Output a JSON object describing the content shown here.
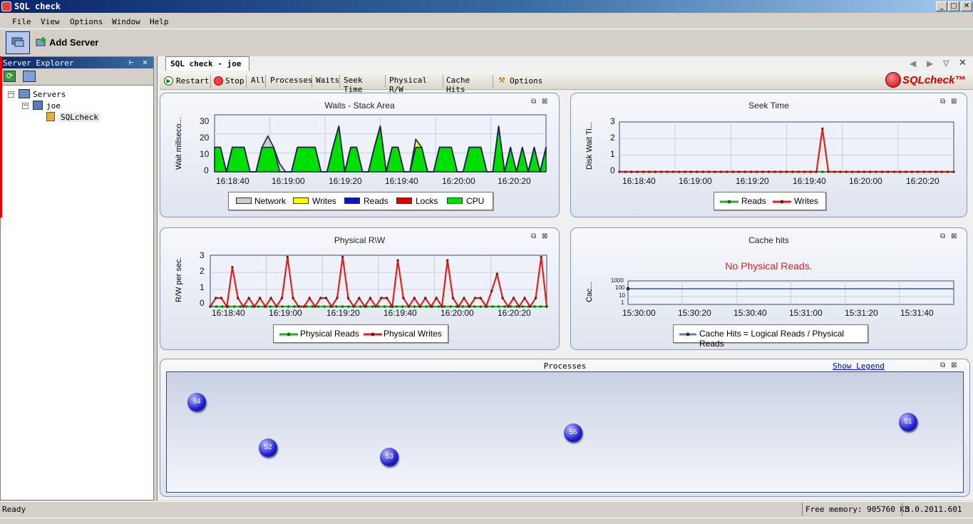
{
  "window": {
    "title": "SQL check"
  },
  "menu": [
    "File",
    "View",
    "Options",
    "Window",
    "Help"
  ],
  "toolbar": {
    "add_server": "Add Server"
  },
  "explorer": {
    "title": "Server Explorer",
    "tree": {
      "root": "Servers",
      "server": "joe",
      "db": "SQLcheck"
    }
  },
  "doc_tab": "SQL check - joe",
  "view_bar": {
    "restart": "Restart",
    "stop": "Stop",
    "views": [
      "All",
      "Processes",
      "Waits",
      "Seek Time",
      "Physical R/W",
      "Cache Hits"
    ],
    "options": "Options"
  },
  "brand": {
    "logo": "SQLcheck™"
  },
  "panels": {
    "waits": {
      "title": "Waits - Stack Area",
      "ylabel": "Wait millseco...",
      "yticks": [
        "30",
        "20",
        "10",
        "0"
      ],
      "xticks": [
        "16:18:40",
        "16:19:00",
        "16:19:20",
        "16:19:40",
        "16:20:00",
        "16:20:20"
      ],
      "legend": [
        "Network",
        "Writes",
        "Reads",
        "Locks",
        "CPU"
      ],
      "colors": [
        "#c8ccd4",
        "#ffff00",
        "#1010c0",
        "#e00000",
        "#00e000"
      ]
    },
    "seek": {
      "title": "Seek Time",
      "ylabel": "Disk Wait Ti...",
      "yticks": [
        "3",
        "2",
        "1",
        "0"
      ],
      "xticks": [
        "16:18:40",
        "16:19:00",
        "16:19:20",
        "16:19:40",
        "16:20:00",
        "16:20:20"
      ],
      "legend": [
        "Reads",
        "Writes"
      ]
    },
    "physical": {
      "title": "Physical R\\W",
      "ylabel": "R/W per sec.",
      "yticks": [
        "3",
        "2",
        "1",
        "0"
      ],
      "xticks": [
        "16:18:40",
        "16:19:00",
        "16:19:20",
        "16:19:40",
        "16:20:00",
        "16:20:20"
      ],
      "legend": [
        "Physical Reads",
        "Physical Writes"
      ]
    },
    "cache": {
      "title": "Cache hits",
      "message": "No Physical Reads.",
      "ylabel": "Cac...",
      "yticks": [
        "1000",
        "100",
        "10",
        "1"
      ],
      "xticks": [
        "15:30:00",
        "15:30:20",
        "15:30:40",
        "15:31:00",
        "15:31:20",
        "15:31:40"
      ],
      "legend": [
        "Cache Hits = Logical Reads / Physical Reads"
      ]
    },
    "processes": {
      "title": "Processes",
      "show_legend": "Show Legend",
      "balls": [
        "54",
        "52",
        "53",
        "56",
        "51"
      ]
    }
  },
  "chart_data": [
    {
      "type": "area",
      "title": "Waits - Stack Area",
      "ylabel": "Wait millseco...",
      "ylim": [
        0,
        35
      ],
      "series": [
        {
          "name": "CPU",
          "values": [
            15,
            15,
            0,
            15,
            15,
            15,
            0,
            0,
            15,
            15,
            15,
            0,
            0,
            0,
            15,
            15,
            15,
            15,
            0,
            0,
            15,
            28,
            0,
            15,
            15,
            0,
            0,
            15,
            28,
            0,
            15,
            15,
            0,
            0,
            15,
            15,
            0,
            0,
            15,
            15,
            15,
            0,
            0,
            15,
            15,
            15,
            0,
            0,
            28,
            0,
            15,
            0,
            15,
            0,
            15,
            0,
            15
          ]
        },
        {
          "name": "Locks",
          "values": [
            0,
            0,
            0,
            0,
            0,
            0,
            0,
            0,
            0,
            0,
            0,
            0,
            0,
            0,
            0,
            0,
            0,
            0,
            0,
            0,
            0,
            0,
            0,
            0,
            0,
            0,
            0,
            0,
            0,
            0,
            0,
            0,
            0,
            0,
            0,
            0,
            0,
            0,
            0,
            0,
            0,
            0,
            0,
            0,
            0,
            0,
            0,
            0,
            0,
            0,
            0,
            0,
            0,
            0,
            0,
            0,
            0
          ]
        },
        {
          "name": "Reads",
          "values": [
            0,
            0,
            0,
            0,
            0,
            0,
            0,
            0,
            0,
            0,
            0,
            0,
            0,
            0,
            0,
            0,
            0,
            0,
            0,
            0,
            0,
            0,
            0,
            0,
            0,
            0,
            0,
            0,
            0,
            0,
            0,
            0,
            0,
            0,
            0,
            0,
            0,
            0,
            0,
            0,
            0,
            0,
            0,
            0,
            0,
            0,
            0,
            0,
            0,
            0,
            0,
            0,
            0,
            0,
            0,
            0,
            0
          ]
        },
        {
          "name": "Writes",
          "values": [
            0,
            0,
            0,
            0,
            0,
            0,
            0,
            0,
            0,
            0,
            0,
            0,
            0,
            0,
            0,
            0,
            0,
            0,
            0,
            0,
            0,
            0,
            0,
            0,
            0,
            0,
            0,
            0,
            0,
            0,
            0,
            0,
            0,
            0,
            5,
            0,
            0,
            0,
            0,
            0,
            0,
            0,
            0,
            0,
            0,
            0,
            0,
            0,
            0,
            0,
            0,
            0,
            0,
            0,
            0,
            0,
            0
          ]
        },
        {
          "name": "Network",
          "values": [
            0,
            0,
            0,
            0,
            0,
            0,
            0,
            0,
            0,
            7,
            0,
            5,
            0,
            0,
            0,
            0,
            0,
            0,
            0,
            0,
            0,
            0,
            0,
            0,
            0,
            0,
            0,
            0,
            0,
            0,
            0,
            0,
            0,
            0,
            0,
            0,
            0,
            0,
            0,
            0,
            0,
            0,
            0,
            0,
            0,
            0,
            0,
            0,
            0,
            0,
            0,
            0,
            0,
            0,
            0,
            0,
            0
          ]
        }
      ]
    },
    {
      "type": "line",
      "title": "Seek Time",
      "ylabel": "Disk Wait Ti...",
      "ylim": [
        0,
        3
      ],
      "series": [
        {
          "name": "Reads",
          "values": [
            0,
            0,
            0,
            0,
            0,
            0,
            0,
            0,
            0,
            0,
            0,
            0,
            0,
            0,
            0,
            0,
            0,
            0,
            0,
            0,
            0,
            0,
            0,
            0,
            0,
            0,
            0,
            0,
            0,
            0,
            0,
            0,
            0,
            0,
            0,
            0,
            0,
            0,
            0,
            0,
            0,
            0,
            0,
            0,
            0,
            0,
            0,
            0,
            0,
            0,
            0,
            0,
            0,
            0,
            0,
            0,
            0
          ]
        },
        {
          "name": "Writes",
          "values": [
            0,
            0,
            0,
            0,
            0,
            0,
            0,
            0,
            0,
            0,
            0,
            0,
            0,
            0,
            0,
            0,
            0,
            0,
            0,
            0,
            0,
            0,
            0,
            0,
            0,
            0,
            0,
            0,
            0,
            0,
            0,
            0,
            0,
            0,
            2.6,
            0,
            0,
            0,
            0,
            0,
            0,
            0,
            0,
            0,
            0,
            0,
            0,
            0,
            0,
            0,
            0,
            0,
            0,
            0,
            0,
            0,
            0
          ]
        }
      ]
    },
    {
      "type": "line",
      "title": "Physical R\\W",
      "ylabel": "R/W per sec.",
      "ylim": [
        0,
        3
      ],
      "series": [
        {
          "name": "Physical Reads",
          "values": [
            0,
            0,
            0,
            0,
            0,
            0,
            0,
            0,
            0,
            0,
            0,
            0,
            0,
            0,
            0,
            0,
            0,
            0,
            0,
            0,
            0,
            0,
            0,
            0,
            0,
            0,
            0,
            0,
            0,
            0,
            0,
            0,
            0,
            0,
            0,
            0,
            0,
            0,
            0,
            0,
            0,
            0,
            0,
            0,
            0,
            0,
            0,
            0,
            0,
            0,
            0,
            0,
            0,
            0,
            0,
            0,
            0
          ]
        },
        {
          "name": "Physical Writes",
          "values": [
            0,
            0.5,
            0.5,
            0,
            2.3,
            0.5,
            0,
            0.5,
            0,
            0.5,
            0,
            0.5,
            0,
            0.5,
            2.9,
            0.5,
            0,
            0,
            0.5,
            0,
            0.5,
            0.5,
            0,
            0.5,
            2.9,
            0.5,
            0,
            0.5,
            0,
            0.5,
            0,
            0.5,
            0.5,
            0,
            2.7,
            0.5,
            0,
            0.5,
            0,
            0.5,
            0,
            0.5,
            0,
            2.7,
            0.5,
            0,
            0.5,
            0,
            0.5,
            0.5,
            0,
            0.9,
            1.9,
            0.5,
            0,
            0.5,
            0,
            0.5,
            0,
            0.5,
            2.9,
            0
          ]
        }
      ]
    },
    {
      "type": "line",
      "title": "Cache hits",
      "ylabel": "Cac...",
      "ylim": [
        1,
        1000
      ],
      "yscale": "log",
      "series": [
        {
          "name": "Cache Hits = Logical Reads / Physical Reads",
          "values": [
            100,
            100
          ]
        }
      ]
    }
  ],
  "status": {
    "left": "Ready",
    "memory": "Free memory: 905760 Kb",
    "version": "3.0.2011.601"
  }
}
